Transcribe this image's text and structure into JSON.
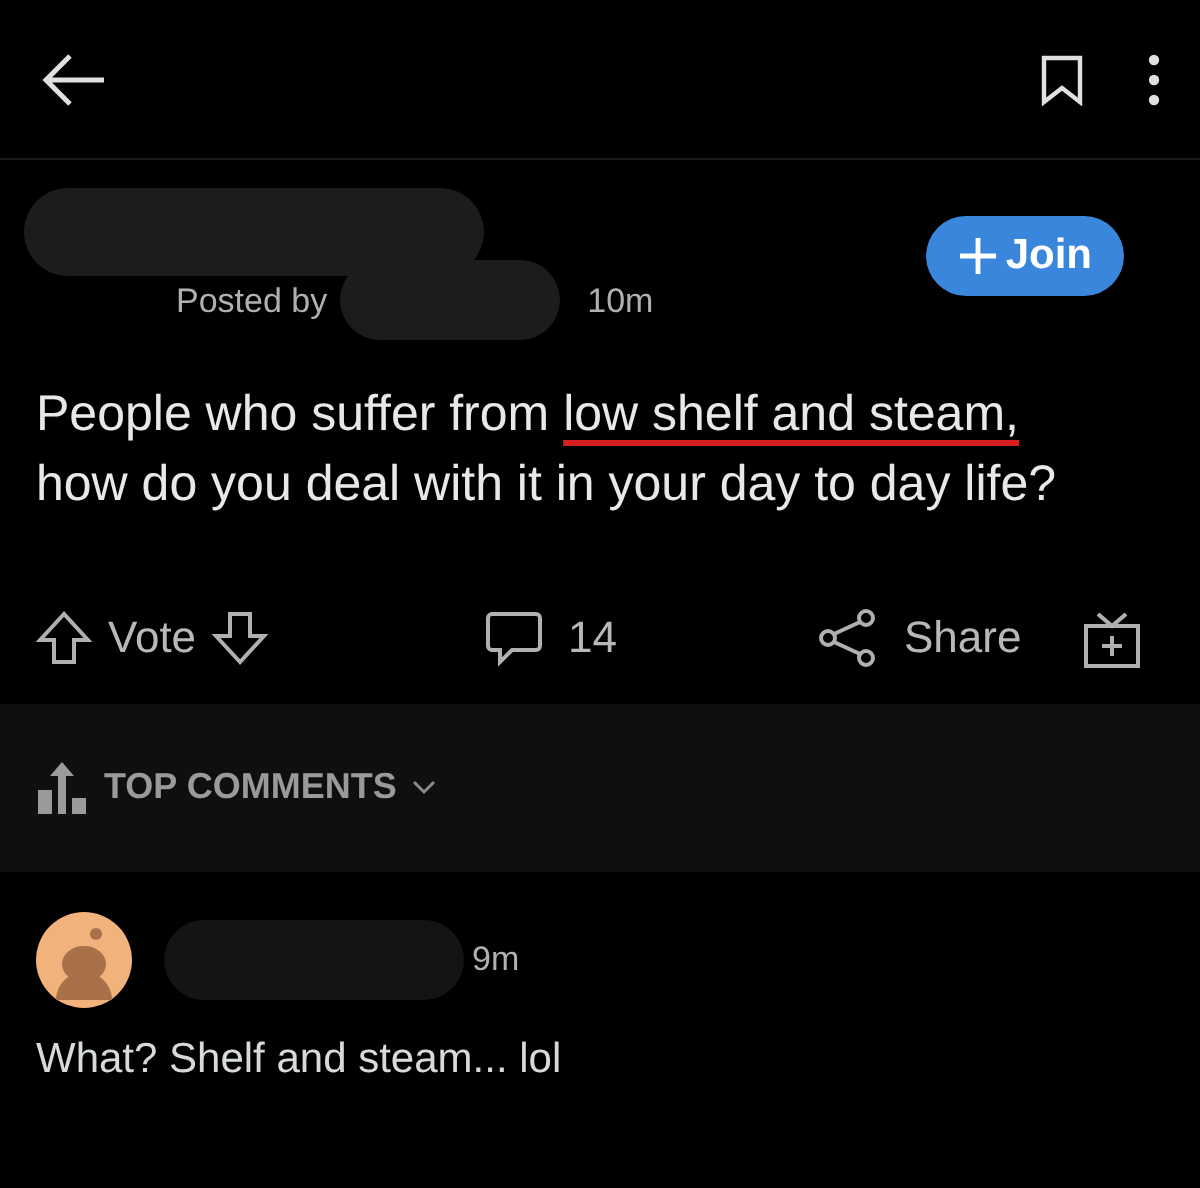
{
  "header": {
    "bookmark_saved": false
  },
  "post": {
    "posted_by": "Posted by",
    "time": "10m",
    "join_label": "Join",
    "title_parts": [
      {
        "text": "People who suffer from ",
        "underlined": false
      },
      {
        "text": "low shelf and",
        "underlined": true
      },
      {
        "text": " steam,",
        "underlined": true
      },
      {
        "text": " how do you deal with it in your day to day life?",
        "underlined": false
      }
    ],
    "vote_label": "Vote",
    "comment_count": "14",
    "share_label": "Share"
  },
  "sort": {
    "label": "TOP COMMENTS"
  },
  "comments": [
    {
      "time": "9m",
      "text": "What? Shelf and steam... lol"
    }
  ]
}
